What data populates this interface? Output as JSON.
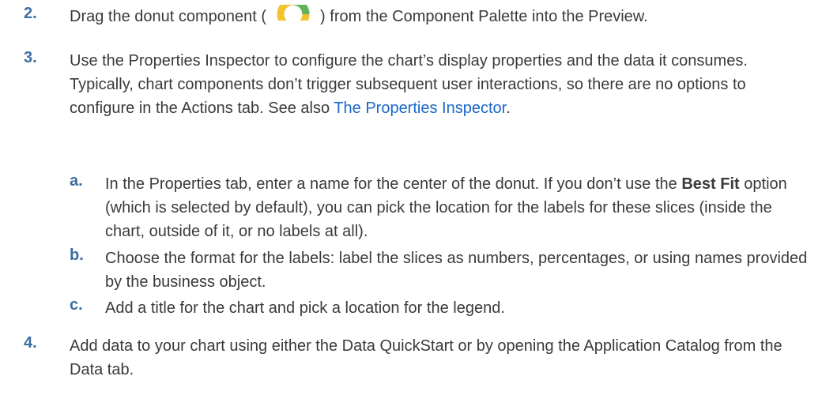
{
  "steps": [
    {
      "number": "2.",
      "before_icon": "Drag the donut component (",
      "icon": "donut-chart-icon",
      "after_icon": ") from the Component Palette into the Preview."
    },
    {
      "number": "3.",
      "text": "Use the Properties Inspector to configure the chart’s display properties and the data it consumes. Typically, chart components don’t trigger subsequent user interactions, so there are no options to configure in the Actions tab. See also ",
      "link": "The Properties Inspector",
      "after_link": ".",
      "substeps": [
        {
          "letter": "a.",
          "text_before": "In the Properties tab, enter a name for the center of the donut. If you don’t use the ",
          "bold": "Best Fit",
          "text_after": " option (which is selected by default), you can pick the location for the labels for these slices (inside the chart, outside of it, or no labels at all)."
        },
        {
          "letter": "b.",
          "text": "Choose the format for the labels: label the slices as numbers, percentages, or using names provided by the business object."
        },
        {
          "letter": "c.",
          "text": "Add a title for the chart and pick a location for the legend."
        }
      ]
    },
    {
      "number": "4.",
      "text": "Add data to your chart using either the Data QuickStart or by opening the Application Catalog from the Data tab."
    }
  ],
  "colors": {
    "number": "#3d6fa0",
    "link": "#1a67c8",
    "text": "#3a3a3a",
    "icon_yellow": "#f2c230",
    "icon_green": "#5fb35a"
  }
}
